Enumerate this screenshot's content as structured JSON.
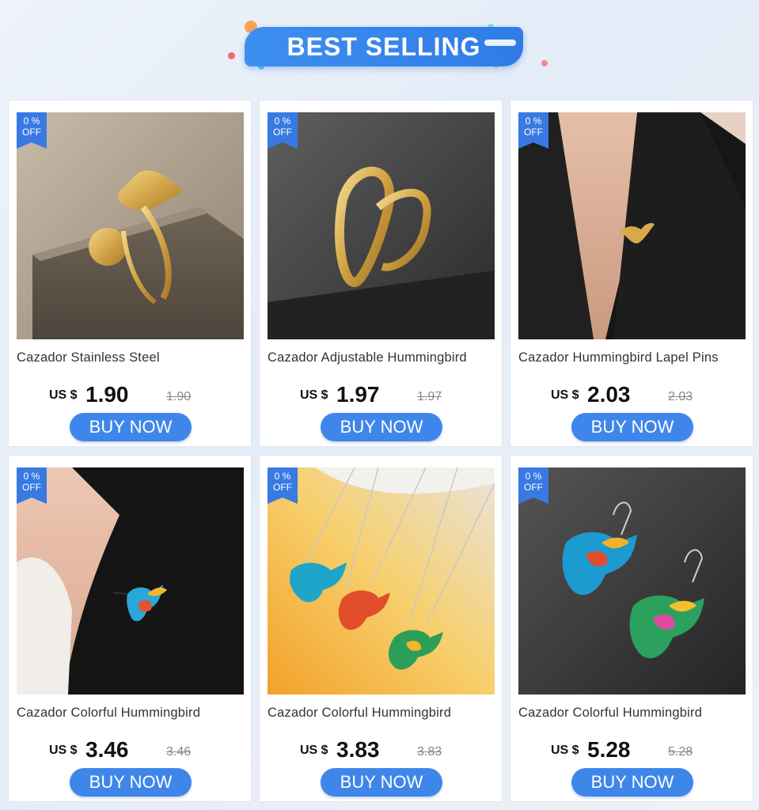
{
  "banner": {
    "title": "BEST SELLING"
  },
  "badge": {
    "line1": "0 %",
    "line2": "OFF"
  },
  "products": [
    {
      "title": "Cazador Stainless Steel",
      "currency": "US $",
      "price": "1.90",
      "original_price": "1.90",
      "button": "BUY NOW",
      "image_icon": "hummingbird-flower-ring"
    },
    {
      "title": "Cazador Adjustable Hummingbird",
      "currency": "US $",
      "price": "1.97",
      "original_price": "1.97",
      "button": "BUY NOW",
      "image_icon": "hummingbird-cutout-ring"
    },
    {
      "title": "Cazador Hummingbird Lapel Pins",
      "currency": "US $",
      "price": "2.03",
      "original_price": "2.03",
      "button": "BUY NOW",
      "image_icon": "hummingbird-lapel-pin"
    },
    {
      "title": "Cazador Colorful Hummingbird",
      "currency": "US $",
      "price": "3.46",
      "original_price": "3.46",
      "button": "BUY NOW",
      "image_icon": "colorful-hummingbird-brooch"
    },
    {
      "title": "Cazador Colorful Hummingbird",
      "currency": "US $",
      "price": "3.83",
      "original_price": "3.83",
      "button": "BUY NOW",
      "image_icon": "colorful-hummingbird-necklaces"
    },
    {
      "title": "Cazador Colorful Hummingbird",
      "currency": "US $",
      "price": "5.28",
      "original_price": "5.28",
      "button": "BUY NOW",
      "image_icon": "colorful-hummingbird-earrings"
    }
  ],
  "colors": {
    "accent": "#3f86ea",
    "badge": "#3979e2",
    "banner": "#3d8ff0"
  }
}
